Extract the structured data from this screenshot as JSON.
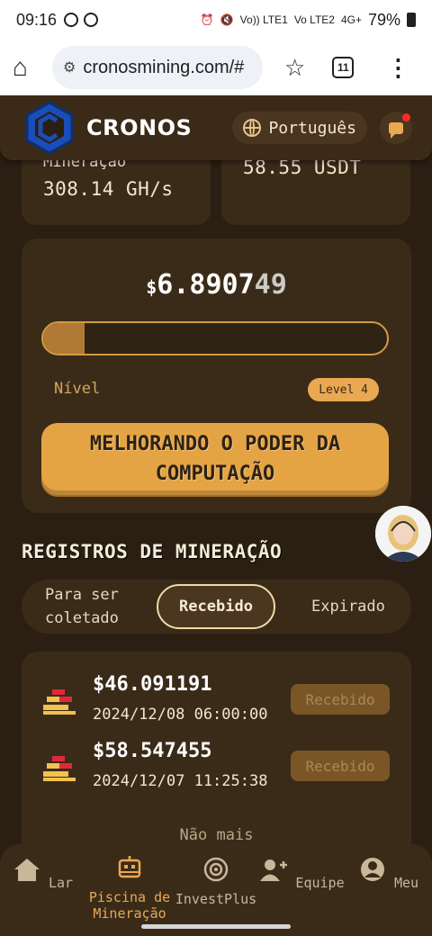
{
  "status_bar": {
    "time": "09:16",
    "battery": "79%",
    "network_labels": [
      "Vo)) LTE1",
      "Vo LTE2",
      "4G+"
    ]
  },
  "browser": {
    "url": "cronosmining.com/#",
    "tab_count": "11"
  },
  "header": {
    "brand": "CRONOS",
    "language": "Português",
    "has_notification": true,
    "accent_color": "#e9a952"
  },
  "stats": [
    {
      "label": "Mineração",
      "value": "308.14 GH/s"
    },
    {
      "label": "",
      "value": "58.55 USDT"
    }
  ],
  "level_card": {
    "balance_currency": "$",
    "balance_value": "6.8907",
    "balance_rolling_digits": "49",
    "progress_fraction": 0.12,
    "level_label": "Nível",
    "level_badge": "Level 4",
    "upgrade_button": "MELHORANDO O PODER DA COMPUTAÇÃO"
  },
  "records": {
    "title": "REGISTROS DE MINERAÇÃO",
    "tabs": [
      {
        "label": "Para ser coletado",
        "active": false
      },
      {
        "label": "Recebido",
        "active": true
      },
      {
        "label": "Expirado",
        "active": false
      }
    ],
    "items": [
      {
        "amount": "$46.091191",
        "date": "2024/12/08 06:00:00",
        "status": "Recebido"
      },
      {
        "amount": "$58.547455",
        "date": "2024/12/07 11:25:38",
        "status": "Recebido"
      }
    ],
    "end_text": "Não mais"
  },
  "bottom_nav": [
    {
      "label": "Lar",
      "icon": "home-icon",
      "active": false
    },
    {
      "label": "Piscina de Mineração",
      "icon": "mining-pool-icon",
      "active": true
    },
    {
      "label": "InvestPlus",
      "icon": "investplus-icon",
      "active": false
    },
    {
      "label": "Equipe",
      "icon": "team-icon",
      "active": false
    },
    {
      "label": "Meu",
      "icon": "profile-icon",
      "active": false
    }
  ]
}
